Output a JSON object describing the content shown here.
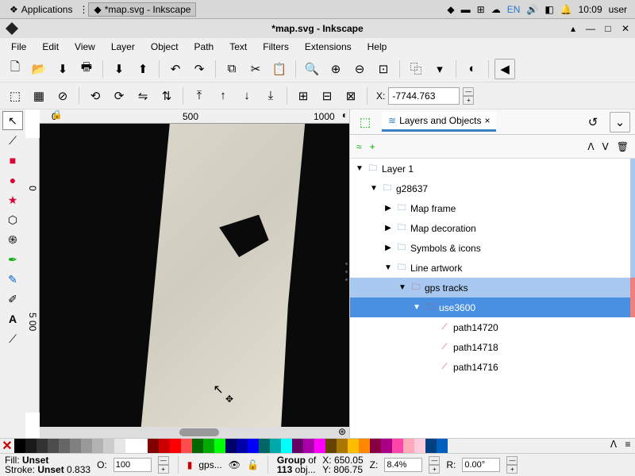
{
  "taskbar": {
    "apps_label": "Applications",
    "window_title": "*map.svg - Inkscape",
    "lang": "EN",
    "time": "10:09",
    "user": "user"
  },
  "titlebar": {
    "title": "*map.svg - Inkscape"
  },
  "menu": {
    "items": [
      "File",
      "Edit",
      "View",
      "Layer",
      "Object",
      "Path",
      "Text",
      "Filters",
      "Extensions",
      "Help"
    ]
  },
  "toolbar2": {
    "x_label": "X:",
    "x_value": "-7744.763"
  },
  "ruler": {
    "h": [
      "0",
      "500",
      "1000"
    ],
    "v": [
      "0",
      "5 00"
    ]
  },
  "panel": {
    "tab_label": "Layers and Objects",
    "tree": [
      {
        "depth": 0,
        "exp": "▼",
        "icon": "folder",
        "label": "Layer 1",
        "color": "#a8c8f0"
      },
      {
        "depth": 1,
        "exp": "▼",
        "icon": "folder",
        "label": "g28637",
        "color": "#a8c8f0"
      },
      {
        "depth": 2,
        "exp": "▶",
        "icon": "folder",
        "label": "Map frame",
        "color": "#a8c8f0"
      },
      {
        "depth": 2,
        "exp": "▶",
        "icon": "folder",
        "label": "Map decoration",
        "color": "#a8c8f0"
      },
      {
        "depth": 2,
        "exp": "▶",
        "icon": "folder",
        "label": "Symbols & icons",
        "color": "#a8c8f0"
      },
      {
        "depth": 2,
        "exp": "▼",
        "icon": "folder",
        "label": "Line artwork",
        "color": "#a8c8f0"
      },
      {
        "depth": 3,
        "exp": "▼",
        "icon": "folder-r",
        "label": "gps tracks",
        "sel": 1,
        "color": "#f08080"
      },
      {
        "depth": 4,
        "exp": "▼",
        "icon": "folder-r",
        "label": "use3600",
        "sel": 2,
        "color": "#f08080"
      },
      {
        "depth": 5,
        "exp": "",
        "icon": "path",
        "label": "path14720",
        "color": ""
      },
      {
        "depth": 5,
        "exp": "",
        "icon": "path",
        "label": "path14718",
        "color": ""
      },
      {
        "depth": 5,
        "exp": "",
        "icon": "path",
        "label": "path14716",
        "color": ""
      }
    ]
  },
  "palette": [
    "#000",
    "#1a1a1a",
    "#333",
    "#4d4d4d",
    "#666",
    "#808080",
    "#999",
    "#b3b3b3",
    "#ccc",
    "#e6e6e6",
    "#fff",
    "",
    "#800000",
    "#c00",
    "#f00",
    "#ff4d4d",
    "#060",
    "#0a0",
    "#0f0",
    "#006",
    "#00a",
    "#00f",
    "#066",
    "#0aa",
    "#0ff",
    "#606",
    "#a0a",
    "#f0f",
    "#640",
    "#a70",
    "#fb0",
    "#f80",
    "#804",
    "#a08",
    "#f4a",
    "#fab",
    "#fcd",
    "#004080",
    "#0060c0"
  ],
  "status": {
    "fill_label": "Fill:",
    "fill_value": "Unset",
    "stroke_label": "Stroke:",
    "stroke_value": "Unset",
    "stroke_w": "0.833",
    "o_label": "O:",
    "o_value": "100",
    "layer": "gps...",
    "group_l1": "Group",
    "group_l2": "of",
    "group_l3": "113",
    "group_l4": "obj...",
    "x_label": "X:",
    "x_value": "650.05",
    "y_label": "Y:",
    "y_value": "806.75",
    "z_label": "Z:",
    "z_value": "8.4%",
    "r_label": "R:",
    "r_value": "0.00°"
  }
}
